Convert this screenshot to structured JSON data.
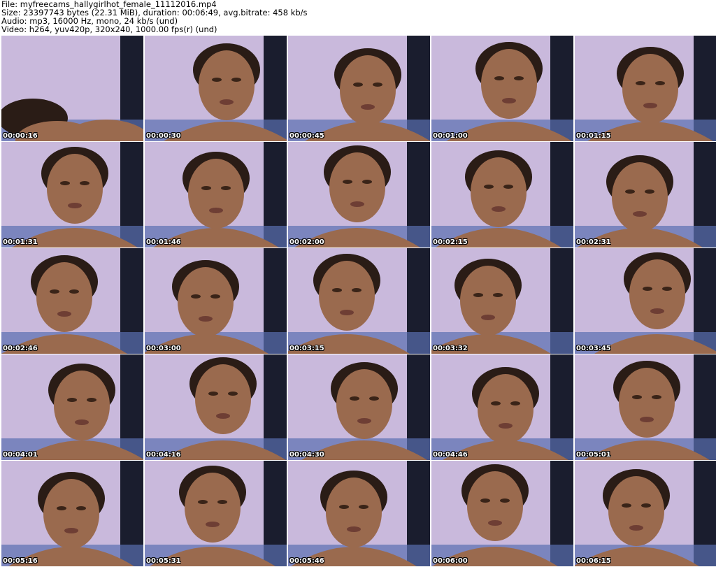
{
  "header": {
    "file": "File: myfreecams_hallygirlhot_female_11112016.mp4",
    "size": "Size: 23397743 bytes (22.31 MiB), duration: 00:06:49, avg.bitrate: 458 kb/s",
    "audio": "Audio: mp3, 16000 Hz, mono, 24 kb/s (und)",
    "video": "Video: h264, yuv420p, 320x240, 1000.00 fps(r) (und)"
  },
  "thumbnails": [
    "00:00:16",
    "00:00:30",
    "00:00:45",
    "00:01:00",
    "00:01:15",
    "00:01:31",
    "00:01:46",
    "00:02:00",
    "00:02:15",
    "00:02:31",
    "00:02:46",
    "00:03:00",
    "00:03:15",
    "00:03:32",
    "00:03:45",
    "00:04:01",
    "00:04:16",
    "00:04:30",
    "00:04:46",
    "00:05:01",
    "00:05:16",
    "00:05:31",
    "00:05:46",
    "00:06:00",
    "00:06:15"
  ],
  "colors": {
    "wall": "#c9b9dc",
    "shelf": "#1a1d2e",
    "skin": "#9a6a4e",
    "hair": "#2a1c16",
    "bedsheet": "#5a6fb0"
  }
}
